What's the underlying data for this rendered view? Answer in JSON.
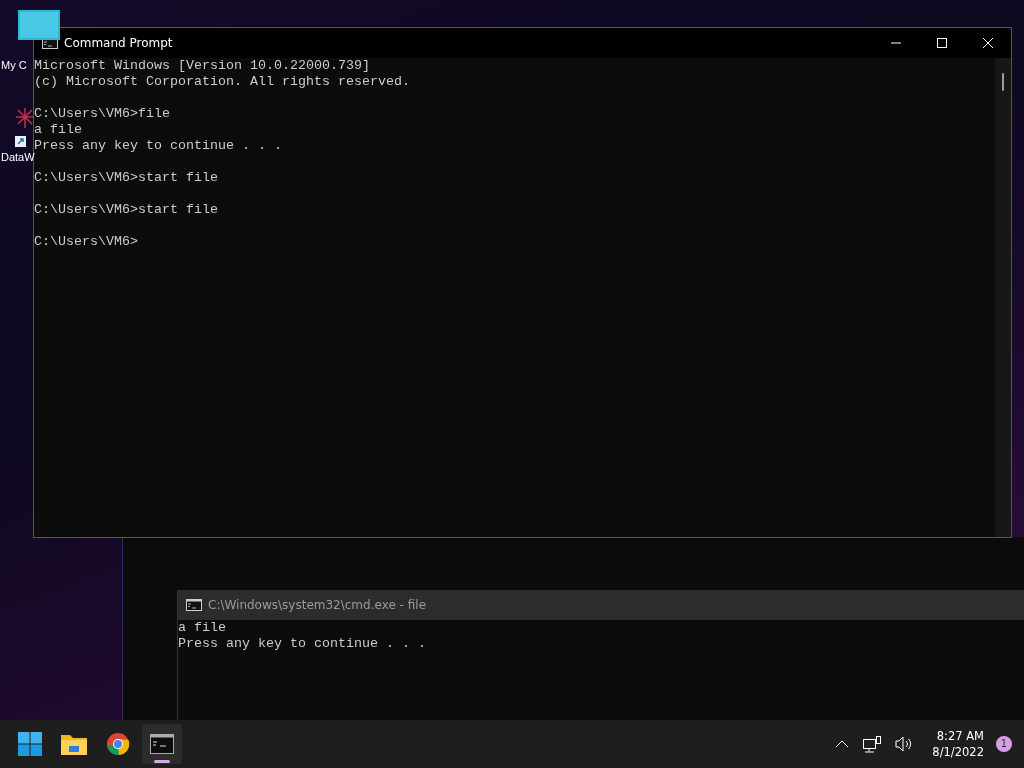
{
  "desktop_icons": [
    {
      "label": "My C",
      "kind": "monitor"
    },
    {
      "label": "DataW",
      "kind": "shortcut"
    }
  ],
  "main_window": {
    "title": "Command Prompt",
    "active": true,
    "output": [
      [
        "Microsoft Windows [Version 10.0.22000.739]",
        "(c) Microsoft Corporation. All rights reserved."
      ],
      [
        "C:\\Users\\VM6>file",
        "a file",
        "Press any key to continue . . ."
      ],
      [
        "C:\\Users\\VM6>start file"
      ],
      [
        "C:\\Users\\VM6>start file"
      ],
      [
        "C:\\Users\\VM6>"
      ]
    ]
  },
  "second_window": {
    "title": "C:\\Windows\\system32\\cmd.exe - file",
    "active": false,
    "output": [
      [
        "a file",
        "Press any key to continue . . ."
      ]
    ]
  },
  "taskbar": {
    "apps": [
      {
        "kind": "start",
        "running": false
      },
      {
        "kind": "explorer",
        "running": false
      },
      {
        "kind": "chrome",
        "running": false
      },
      {
        "kind": "terminal",
        "running": true
      }
    ],
    "time": "8:27 AM",
    "date": "8/1/2022",
    "notification_count": "1"
  }
}
